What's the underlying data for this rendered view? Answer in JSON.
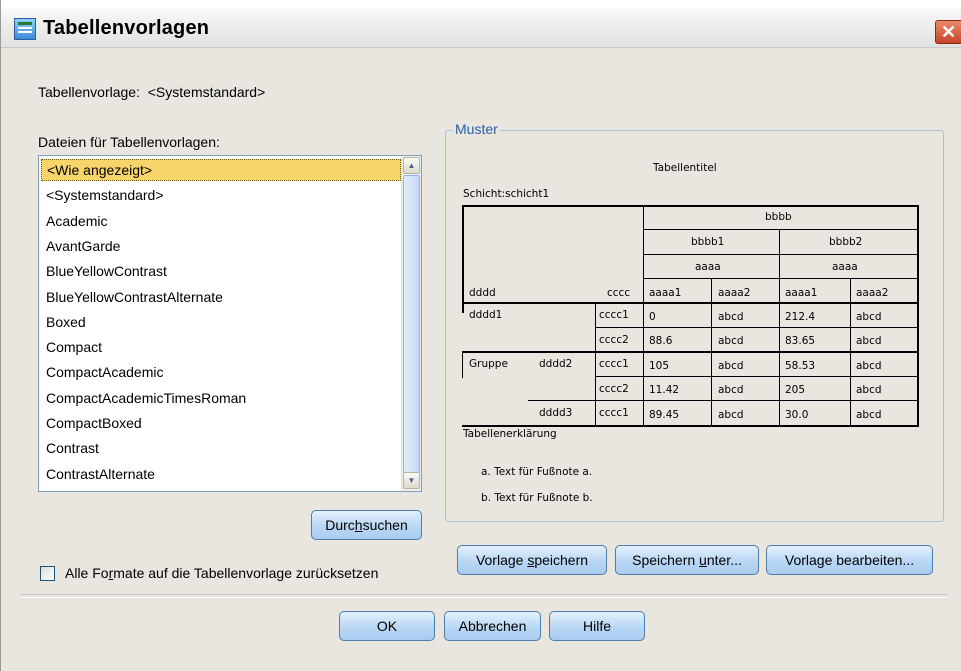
{
  "window": {
    "title": "Tabellenvorlagen",
    "close_glyph": "✕",
    "icon": "app-table-icon"
  },
  "tablelook": {
    "label": "Tabellenvorlage:",
    "value": "<Systemstandard>"
  },
  "files": {
    "label": "Dateien für Tabellenvorlagen:",
    "items": [
      "<Wie angezeigt>",
      "<Systemstandard>",
      "Academic",
      "AvantGarde",
      "BlueYellowContrast",
      "BlueYellowContrastAlternate",
      "Boxed",
      "Compact",
      "CompactAcademic",
      "CompactAcademicTimesRoman",
      "CompactBoxed",
      "Contrast",
      "ContrastAlternate"
    ],
    "selected_index": 0
  },
  "browse_button": {
    "pre": "Durc",
    "u": "h",
    "post": "suchen"
  },
  "reset_checkbox": {
    "pre": "Alle Fo",
    "u": "r",
    "post": "mate auf die Tabellenvorlage zurücksetzen",
    "checked": false
  },
  "sample": {
    "group_label": "Muster",
    "table_title": "Tabellentitel",
    "layer": "Schicht:schicht1",
    "col_top": "bbbb",
    "col_mid": [
      "bbbb1",
      "bbbb2"
    ],
    "col_sub": [
      "aaaa",
      "aaaa"
    ],
    "row_dim": "dddd",
    "row_dim2": "cccc",
    "col_leaf": [
      "aaaa1",
      "aaaa2",
      "aaaa1",
      "aaaa2"
    ],
    "row_group": "Gruppe",
    "rows": [
      {
        "r1": "dddd1",
        "r2": "",
        "r3": "cccc1",
        "cells": [
          "0",
          "abcd",
          "212.4",
          "abcd"
        ]
      },
      {
        "r1": "",
        "r2": "",
        "r3": "cccc2",
        "cells": [
          "88.6",
          "abcd",
          "83.65",
          "abcd"
        ]
      },
      {
        "r1": "",
        "r2": "dddd2",
        "r3": "cccc1",
        "cells": [
          "105",
          "abcd",
          "58.53",
          "abcd"
        ]
      },
      {
        "r1": "",
        "r2": "",
        "r3": "cccc2",
        "cells": [
          "11.42",
          "abcd",
          "205",
          "abcd"
        ]
      },
      {
        "r1": "",
        "r2": "dddd3",
        "r3": "cccc1",
        "cells": [
          "89.45",
          "abcd",
          "30.0",
          "abcd"
        ]
      }
    ],
    "caption": "Tabellenerklärung",
    "footnotes": [
      "a. Text für Fußnote a.",
      "b. Text für Fußnote b."
    ]
  },
  "buttons": {
    "save": {
      "pre": "Vorlage ",
      "u": "s",
      "post": "peichern"
    },
    "save_as": {
      "pre": "Speichern ",
      "u": "u",
      "post": "nter..."
    },
    "edit": {
      "pre": "Vorla",
      "u": "g",
      "post": "e bearbeiten..."
    },
    "ok": "OK",
    "cancel": "Abbrechen",
    "help": "Hilfe"
  },
  "colors": {
    "selection": "#f7d56a",
    "button": "#b9d7f4",
    "group_label": "#2a5ea8",
    "dialog_bg": "#e9e6df"
  }
}
